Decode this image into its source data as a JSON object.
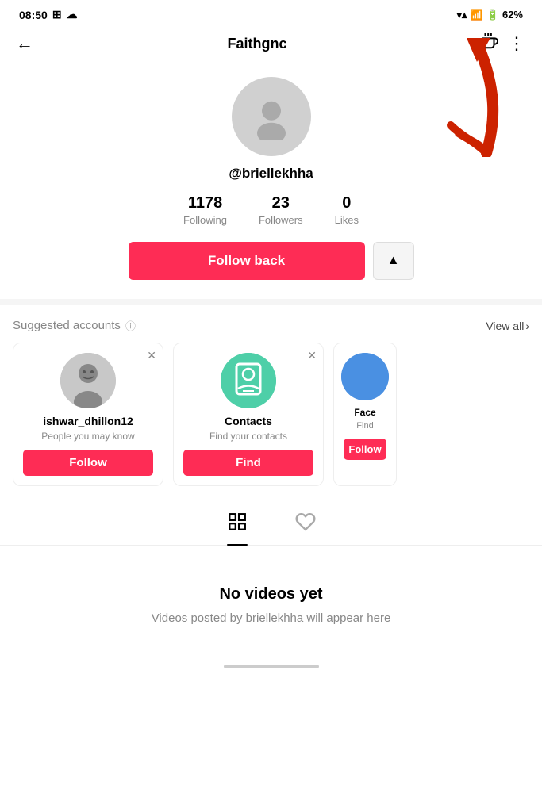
{
  "statusBar": {
    "time": "08:50",
    "battery": "62%"
  },
  "topNav": {
    "title": "Faithgnc",
    "backLabel": "←"
  },
  "profile": {
    "username": "@briellekhha",
    "stats": [
      {
        "value": "1178",
        "label": "Following"
      },
      {
        "value": "23",
        "label": "Followers"
      },
      {
        "value": "0",
        "label": "Likes"
      }
    ],
    "followBackLabel": "Follow back",
    "shareIcon": "▲"
  },
  "suggested": {
    "title": "Suggested accounts",
    "viewAll": "View all",
    "accounts": [
      {
        "name": "ishwar_dhillon12",
        "desc": "People you may know",
        "btnLabel": "Follow",
        "type": "person"
      },
      {
        "name": "Contacts",
        "desc": "Find your contacts",
        "btnLabel": "Find",
        "type": "contacts"
      },
      {
        "name": "Face",
        "desc": "Find",
        "btnLabel": "Follow",
        "type": "face"
      }
    ]
  },
  "tabs": [
    {
      "icon": "grid",
      "active": true
    },
    {
      "icon": "heart",
      "active": false
    }
  ],
  "emptyState": {
    "title": "No videos yet",
    "desc": "Videos posted by briellekhha will appear here"
  }
}
